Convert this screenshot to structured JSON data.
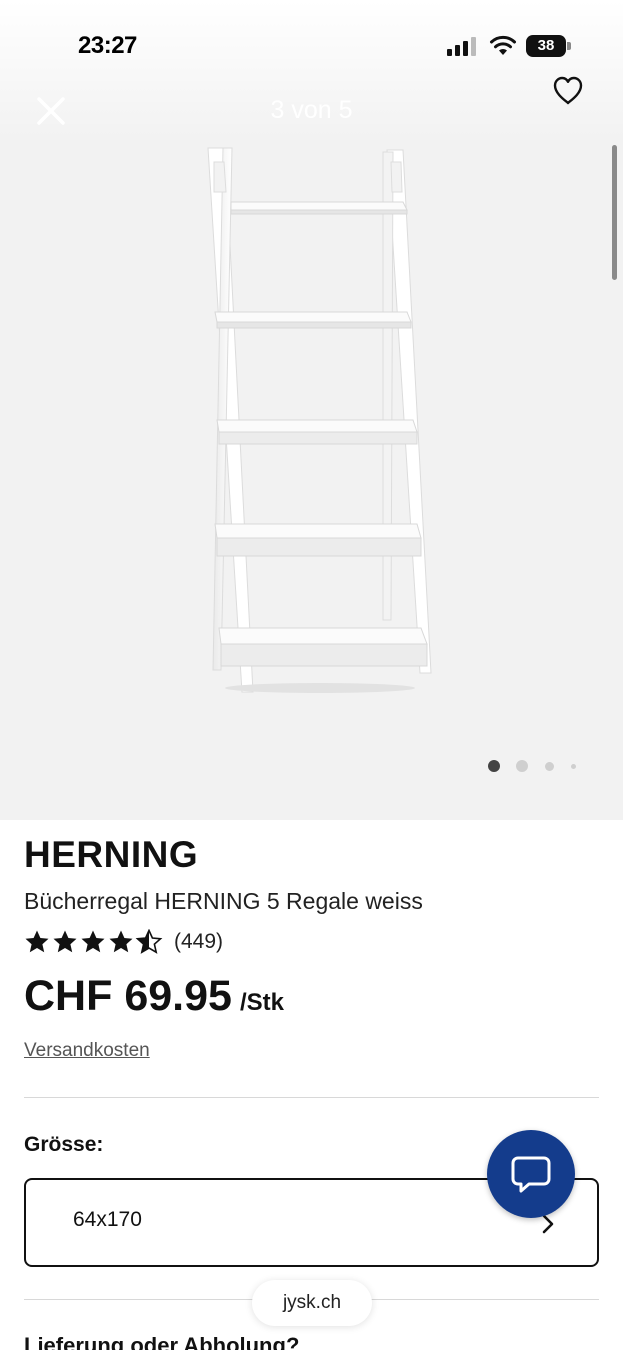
{
  "status_bar": {
    "time": "23:27",
    "battery": "38"
  },
  "gallery": {
    "counter": "3 von 5",
    "image_alt": "Bücherregal HERNING weiss",
    "dots_total": 4,
    "active_dot": 0
  },
  "product": {
    "brand": "HERNING",
    "subtitle": "Bücherregal HERNING 5 Regale weiss",
    "rating": 4.5,
    "review_count": "(449)",
    "price": "CHF 69.95",
    "price_unit": "/Stk",
    "shipping_link": "Versandkosten"
  },
  "size": {
    "label": "Grösse:",
    "selected": "64x170"
  },
  "browser": {
    "url": "jysk.ch"
  },
  "next_section": {
    "title": "Lieferung oder Abholung?"
  },
  "colors": {
    "chat_button": "#143c8c",
    "gallery_bg": "#f2f2f2"
  },
  "icons": {
    "close": "close-icon",
    "favorite": "heart-icon",
    "chat": "chat-bubble-icon",
    "chevron": "chevron-right-icon"
  }
}
